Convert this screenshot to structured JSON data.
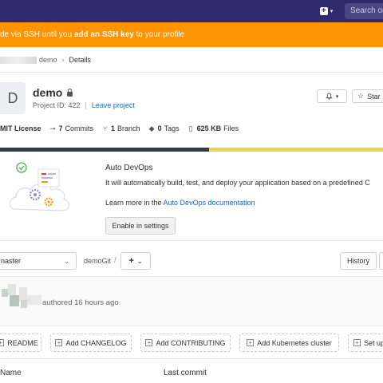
{
  "nav": {
    "search_placeholder": "Search or"
  },
  "banner": {
    "prefix": "de via SSH until you ",
    "link": "add an SSH key",
    "suffix": " to your profile"
  },
  "breadcrumb": {
    "parent": "demo",
    "separator": "›",
    "current": "Details"
  },
  "project": {
    "avatar_letter": "D",
    "name": "demo",
    "id_label": "Project ID: 422",
    "leave_label": "Leave project",
    "star_label": "Star"
  },
  "stats": {
    "license": "MIT License",
    "commits_count": "7",
    "commits_label": "Commits",
    "branch_count": "1",
    "branch_label": "Branch",
    "tags_count": "0",
    "tags_label": "Tags",
    "files_size": "625 KB",
    "files_label": "Files"
  },
  "autodevops": {
    "title": "Auto DevOps",
    "description": "It will automatically build, test, and deploy your application based on a predefined C",
    "learn_prefix": "Learn more in the ",
    "learn_link": "Auto DevOps documentation",
    "enable_button": "Enable in settings"
  },
  "repo": {
    "branch": "naster",
    "path": "demoGit",
    "path_separator": "/",
    "add_button": "+",
    "history_button": "History"
  },
  "commit": {
    "text": "authored 16 hours ago"
  },
  "quick_buttons": {
    "readme": "README",
    "changelog": "Add CHANGELOG",
    "contributing": "Add CONTRIBUTING",
    "kubernetes": "Add Kubernetes cluster",
    "setup": "Set up"
  },
  "table": {
    "col_name": "Name",
    "col_last_commit": "Last commit"
  },
  "colors": {
    "nav": "#2f2a6b",
    "banner": "#fc9403",
    "link": "#1f67b8",
    "lang_dark": "#2f3a4d",
    "lang_yellow": "#f0d24c"
  }
}
